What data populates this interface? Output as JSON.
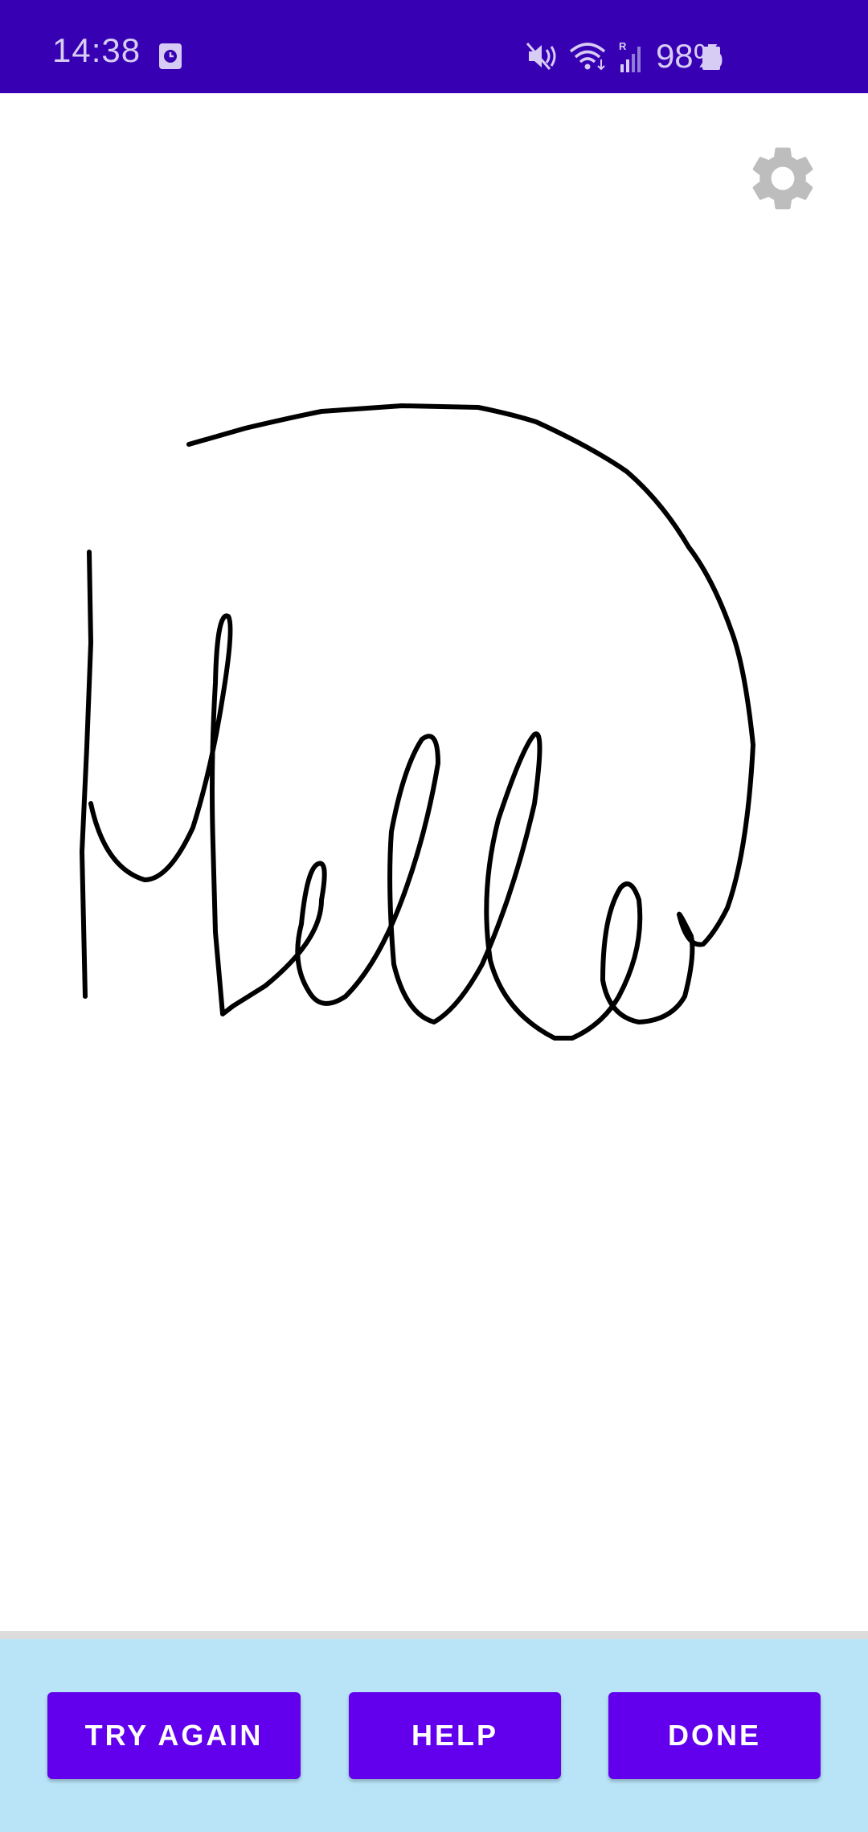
{
  "status_bar": {
    "time": "14:38",
    "battery_percent": "98%",
    "background_color": "#3700b3",
    "icons": [
      "calendar-icon",
      "mute-icon",
      "wifi-icon",
      "signal-icon",
      "battery-icon"
    ]
  },
  "canvas": {
    "settings_icon": "gear-icon",
    "ink_color": "#000000",
    "recognized_content": "handwritten-word"
  },
  "actions": {
    "try_again_label": "TRY AGAIN",
    "help_label": "HELP",
    "done_label": "DONE",
    "button_color": "#6200ee",
    "bar_color": "#b9e4f8"
  }
}
